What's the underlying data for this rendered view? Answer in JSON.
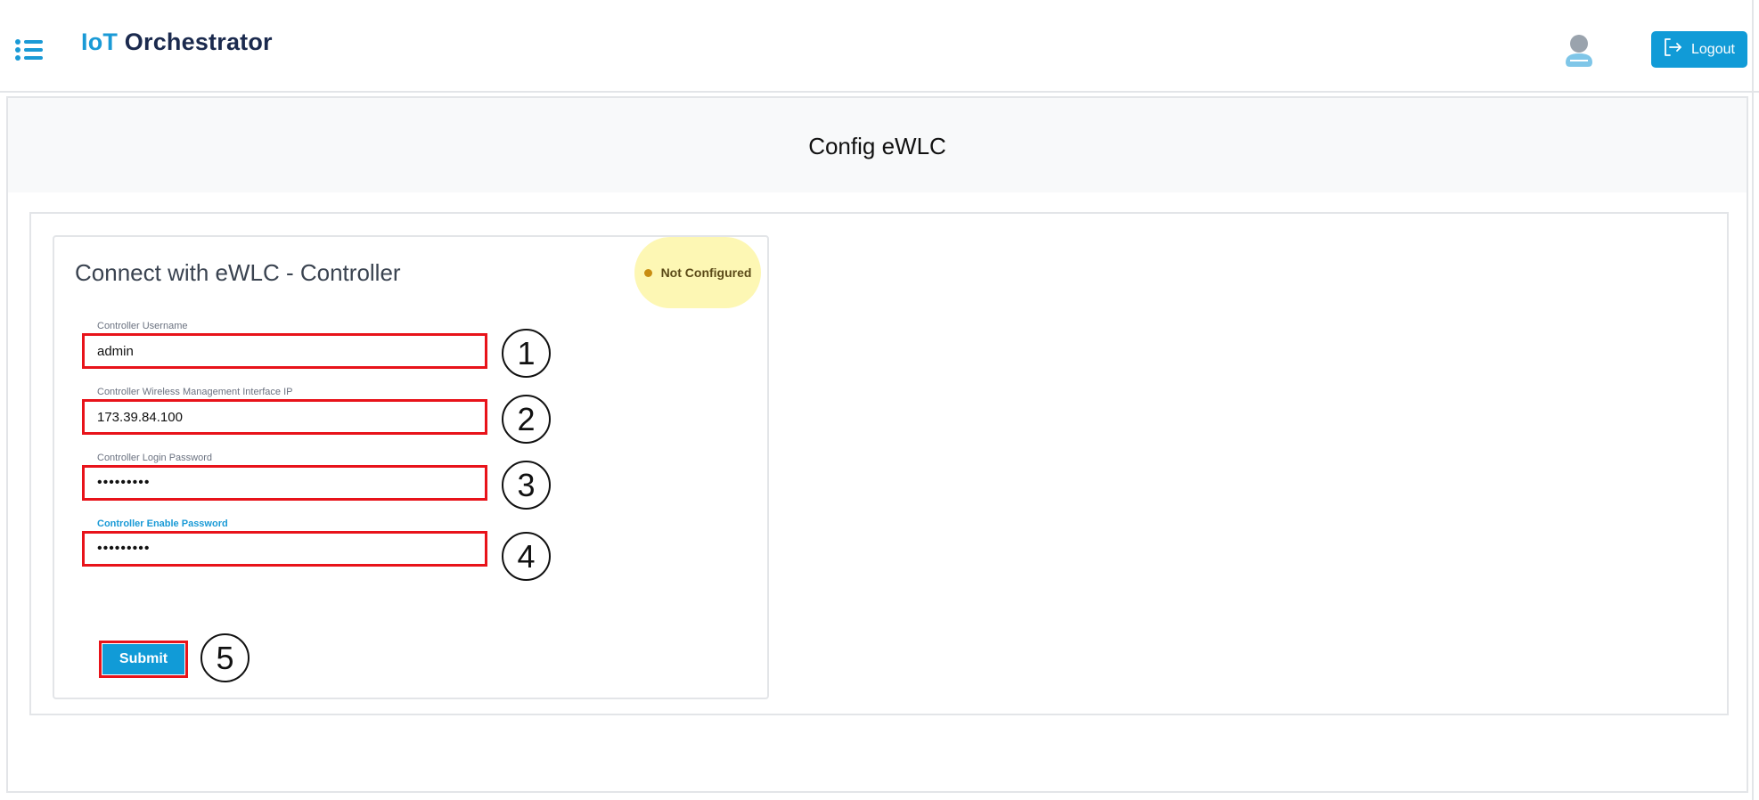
{
  "header": {
    "brand_prefix": "IoT",
    "brand_name": "Orchestrator",
    "logout_label": "Logout"
  },
  "page": {
    "title": "Config eWLC"
  },
  "card": {
    "title": "Connect with eWLC - Controller",
    "status": "Not Configured"
  },
  "fields": [
    {
      "label": "Controller Username",
      "value": "admin",
      "step": "1"
    },
    {
      "label": "Controller Wireless Management Interface IP",
      "value": "173.39.84.100",
      "step": "2"
    },
    {
      "label": "Controller Login Password",
      "value": "•••••••••",
      "step": "3"
    },
    {
      "label": "Controller Enable Password",
      "value": "•••••••••",
      "step": "4"
    }
  ],
  "submit": {
    "label": "Submit",
    "step": "5"
  },
  "colors": {
    "brand_blue": "#1a9ad6",
    "brand_dark": "#1b2a4e",
    "button_blue": "#119bd7",
    "highlight_red": "#e8131a",
    "status_bg": "#fdf7b4",
    "status_dot": "#c88d12"
  },
  "icons": {
    "menu": "list-icon",
    "avatar": "user-icon",
    "logout": "logout-icon"
  }
}
